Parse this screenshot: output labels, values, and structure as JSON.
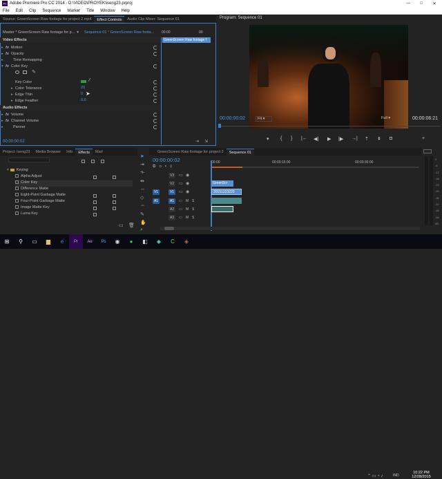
{
  "window": {
    "title": "Adobe Premiere Pro CC 2014 - D:\\VIDEO\\PROYEK\\iseng23.prproj",
    "logo_text": "Pr",
    "controls": [
      "—",
      "□",
      "✕"
    ]
  },
  "menu": [
    "File",
    "Edit",
    "Clip",
    "Sequence",
    "Marker",
    "Title",
    "Window",
    "Help"
  ],
  "source_panel": {
    "tabs": [
      {
        "label": "Source: GreenScreen Raw footage for project 2.mp4"
      },
      {
        "label": "Effect Controls",
        "active": true
      },
      {
        "label": "Audio Clip Mixer: Sequence 01"
      }
    ],
    "master_label": "Master * GreenScreen Raw footage for p...",
    "sequence_label": "Sequence 01 * GreenScreen Raw foota...",
    "timecode_ruler": [
      "00:00",
      "00"
    ],
    "clip_bar_label": "GreenScreen Raw footage f",
    "video_effects_header": "Video Effects",
    "audio_effects_header": "Audio Effects",
    "video_rows": [
      {
        "label": "Motion",
        "fx": "fx",
        "open": false
      },
      {
        "label": "Opacity",
        "fx": "fx",
        "open": false
      },
      {
        "label": "Time Remapping",
        "fx": "",
        "open": false
      },
      {
        "label": "Color Key",
        "fx": "fx",
        "open": true
      }
    ],
    "color_key_params": [
      {
        "label": "Key Color",
        "value": ""
      },
      {
        "label": "Color Tolerance",
        "value": "20"
      },
      {
        "label": "Edge Thin",
        "value": "0"
      },
      {
        "label": "Edge Feather",
        "value": "0.0"
      }
    ],
    "key_color": "#2ea043",
    "audio_rows": [
      {
        "label": "Volume",
        "fx": "fx"
      },
      {
        "label": "Channel Volume",
        "fx": "fx"
      },
      {
        "label": "Panner",
        "fx": ""
      }
    ],
    "footer_timecode": "00:00:00:02"
  },
  "program_monitor": {
    "tab": "Program: Sequence 01",
    "timecode_left": "00:00:00:02",
    "fit": "Fit",
    "quality": "Full",
    "timecode_right": "00:00:06:21",
    "transport": [
      "{",
      "}",
      "|←",
      "◀|",
      "▶",
      "|▶",
      "→|"
    ]
  },
  "project_panel": {
    "tabs": [
      {
        "label": "Project: iseng23"
      },
      {
        "label": "Media Browser"
      },
      {
        "label": "Info"
      },
      {
        "label": "Effects",
        "active": true
      },
      {
        "label": "Marl"
      }
    ],
    "folder": "Keying",
    "items": [
      "Alpha Adjust",
      "Color Key",
      "Difference Matte",
      "Eight-Point Garbage Matte",
      "Four-Point Garbage Matte",
      "Image Matte Key",
      "Luma Key"
    ]
  },
  "timeline": {
    "tabs": [
      {
        "label": "GreenScreen Raw footage for project 2"
      },
      {
        "label": "Sequence 01",
        "active": true
      }
    ],
    "timecode": "00:00:00:02",
    "ruler": [
      "00:00",
      "00:00:15:00",
      "00:00:30:00"
    ],
    "tracks": [
      {
        "name": "V3",
        "src": "",
        "kind": "video"
      },
      {
        "name": "V2",
        "src": "",
        "kind": "video"
      },
      {
        "name": "V1",
        "src": "V1",
        "kind": "video"
      },
      {
        "name": "A1",
        "src": "A1",
        "kind": "audio"
      },
      {
        "name": "A2",
        "src": "",
        "kind": "audio"
      },
      {
        "name": "A3",
        "src": "",
        "kind": "audio"
      }
    ],
    "track_flags": [
      "M",
      "S"
    ],
    "clips": [
      {
        "label": "GreenScr"
      },
      {
        "label": "20151223220"
      },
      {
        "label": ""
      },
      {
        "label": ""
      }
    ],
    "meter_scale": [
      "0",
      "-6",
      "-12",
      "-18",
      "-24",
      "-30",
      "-36",
      "-42",
      "-48",
      "-54",
      "dB"
    ]
  },
  "taskbar": {
    "time": "10:22 PM",
    "date": "12/28/2015",
    "lang": "IND"
  },
  "colors": {
    "accent": "#3b80c8",
    "bg": "#232323",
    "clip_video": "#5a8fd0",
    "clip_audio": "#4a8a8a"
  }
}
